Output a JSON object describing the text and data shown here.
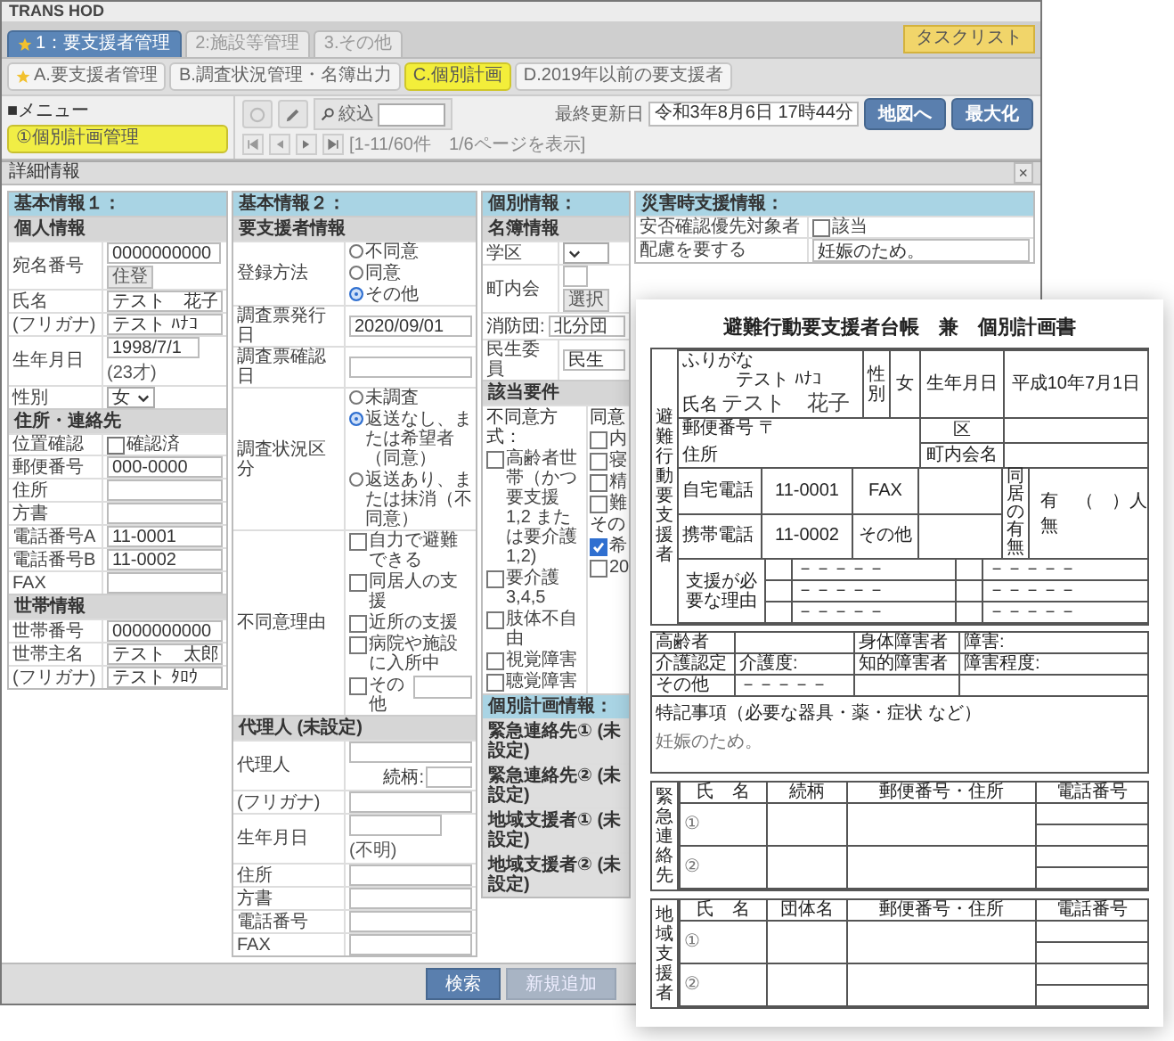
{
  "app": {
    "title": "TRANS HOD",
    "main_tabs": [
      {
        "label": "1：要支援者管理",
        "selected": true,
        "starred": true
      },
      {
        "label": "2:施設等管理",
        "selected": false,
        "starred": false
      },
      {
        "label": "3.その他",
        "selected": false,
        "starred": false
      }
    ],
    "task_button": "タスクリスト",
    "sub_tabs": [
      {
        "label": "A.要支援者管理",
        "selected": false,
        "starred": true
      },
      {
        "label": "B.調査状況管理・名簿出力",
        "selected": false,
        "starred": false
      },
      {
        "label": "C.個別計画",
        "selected": true,
        "starred": false
      },
      {
        "label": "D.2019年以前の要支援者",
        "selected": false,
        "starred": false
      }
    ],
    "menu": {
      "heading": "■メニュー",
      "items": [
        {
          "label": "①個別計画管理",
          "selected": true
        }
      ]
    },
    "toolbar": {
      "filter_label": "絞込",
      "paging": "[1-11/60件　1/6ページを表示]",
      "updated_label": "最終更新日",
      "updated_value": "令和3年8月6日 17時44分",
      "buttons": [
        "地図へ",
        "最大化"
      ]
    }
  },
  "dialog": {
    "title": "詳細情報",
    "close": "×",
    "panels": [
      {
        "title": "基本情報１：",
        "sections": [
          {
            "title": "個人情報",
            "rows": [
              {
                "kind": "field_button",
                "label": "宛名番号",
                "value": "0000000000",
                "button": "住登"
              },
              {
                "kind": "field",
                "label": "氏名",
                "value": "テスト　花子"
              },
              {
                "kind": "field",
                "label": "(フリガナ)",
                "value": "テスト ﾊﾅｺ"
              },
              {
                "kind": "field_note",
                "label": "生年月日",
                "value": "1998/7/1",
                "note": "(23才)"
              },
              {
                "kind": "select",
                "label": "性別",
                "value": "女"
              }
            ]
          },
          {
            "title": "住所・連絡先",
            "rows": [
              {
                "kind": "checks",
                "label": "位置確認",
                "options": [
                  {
                    "label": "確認済",
                    "checked": false
                  }
                ]
              },
              {
                "kind": "field",
                "label": "郵便番号",
                "value": "000-0000"
              },
              {
                "kind": "field",
                "label": "住所"
              },
              {
                "kind": "field",
                "label": "方書"
              },
              {
                "kind": "field",
                "label": "電話番号A",
                "value": "11-0001"
              },
              {
                "kind": "field",
                "label": "電話番号B",
                "value": "11-0002"
              },
              {
                "kind": "field",
                "label": "FAX"
              }
            ]
          },
          {
            "title": "世帯情報",
            "rows": [
              {
                "kind": "field",
                "label": "世帯番号",
                "value": "0000000000"
              },
              {
                "kind": "field",
                "label": "世帯主名",
                "value": "テスト　太郎"
              },
              {
                "kind": "field",
                "label": "(フリガナ)",
                "value": "テスト ﾀﾛｳ"
              }
            ]
          }
        ]
      },
      {
        "title": "基本情報２：",
        "sections": [
          {
            "title": "要支援者情報",
            "rows": [
              {
                "kind": "radios",
                "label": "登録方法",
                "options": [
                  {
                    "label": "不同意",
                    "selected": false
                  },
                  {
                    "label": "同意",
                    "selected": false
                  },
                  {
                    "label": "その他",
                    "selected": true
                  }
                ]
              },
              {
                "kind": "field",
                "label": "調査票発行日",
                "value": "2020/09/01"
              },
              {
                "kind": "field",
                "label": "調査票確認日"
              },
              {
                "kind": "radios",
                "label": "調査状況区分",
                "options": [
                  {
                    "label": "未調査",
                    "selected": false
                  },
                  {
                    "label": "返送なし、または希望者（同意）",
                    "selected": true
                  },
                  {
                    "label": "返送あり、または抹消（不同意）",
                    "selected": false
                  }
                ]
              },
              {
                "kind": "checks",
                "label": "不同意理由",
                "options": [
                  {
                    "label": "自力で避難できる",
                    "checked": false
                  },
                  {
                    "label": "同居人の支援",
                    "checked": false
                  },
                  {
                    "label": "近所の支援",
                    "checked": false
                  },
                  {
                    "label": "病院や施設に入所中",
                    "checked": false
                  },
                  {
                    "label": "その他",
                    "checked": false,
                    "with_field": true
                  }
                ]
              }
            ]
          },
          {
            "title": "代理人 (未設定)",
            "rows": [
              {
                "kind": "field_relation",
                "label": "代理人",
                "relation": "続柄:"
              },
              {
                "kind": "field",
                "label": "(フリガナ)"
              },
              {
                "kind": "field_note",
                "label": "生年月日",
                "note": "(不明)"
              },
              {
                "kind": "field",
                "label": "住所"
              },
              {
                "kind": "field",
                "label": "方書"
              },
              {
                "kind": "field",
                "label": "電話番号"
              },
              {
                "kind": "field",
                "label": "FAX"
              }
            ]
          }
        ]
      },
      {
        "title": "個別情報：",
        "sections": [
          {
            "title": "名簿情報",
            "rows": [
              {
                "kind": "select",
                "label": "学区"
              },
              {
                "kind": "field_button",
                "label": "町内会",
                "button": "選択"
              },
              {
                "kind": "inline_field",
                "label": "消防団:",
                "value": "北分団"
              },
              {
                "kind": "field",
                "label": "民生委員",
                "value": "民生"
              }
            ]
          },
          {
            "title": "該当要件",
            "rows": [
              {
                "kind": "columns",
                "columns": [
                  [
                    {
                      "kind": "text",
                      "label": "不同意方式："
                    },
                    {
                      "kind": "check",
                      "label": "高齢者世帯（かつ要支援1,2 または要介護1,2)",
                      "checked": false
                    },
                    {
                      "kind": "check",
                      "label": "要介護3,4,5",
                      "checked": false
                    },
                    {
                      "kind": "check",
                      "label": "肢体不自由",
                      "checked": false
                    },
                    {
                      "kind": "check",
                      "label": "視覚障害",
                      "checked": false
                    },
                    {
                      "kind": "check",
                      "label": "聴覚障害",
                      "checked": false
                    }
                  ],
                  [
                    {
                      "kind": "text",
                      "label": "同意"
                    },
                    {
                      "kind": "check",
                      "label": "内",
                      "checked": false
                    },
                    {
                      "kind": "check",
                      "label": "寝",
                      "checked": false
                    },
                    {
                      "kind": "check",
                      "label": "精",
                      "checked": false
                    },
                    {
                      "kind": "check",
                      "label": "難",
                      "checked": false
                    },
                    {
                      "kind": "text",
                      "label": "その"
                    },
                    {
                      "kind": "check",
                      "label": "希",
                      "checked": true
                    },
                    {
                      "kind": "check",
                      "label": "20",
                      "checked": false
                    }
                  ]
                ]
              }
            ]
          },
          {
            "title": "個別計画情報：",
            "kind": "links",
            "rows": [
              {
                "kind": "link",
                "label": "緊急連絡先① (未設定)"
              },
              {
                "kind": "link",
                "label": "緊急連絡先② (未設定)"
              },
              {
                "kind": "link",
                "label": "地域支援者① (未設定)"
              },
              {
                "kind": "link",
                "label": "地域支援者② (未設定)"
              }
            ]
          }
        ]
      },
      {
        "title": "災害時支援情報：",
        "sections": [
          {
            "rows": [
              {
                "kind": "checks",
                "label": "安否確認優先対象者",
                "options": [
                  {
                    "label": "該当",
                    "checked": false
                  }
                ]
              },
              {
                "kind": "textarea",
                "label": "配慮を要する",
                "value": "妊娠のため。"
              }
            ]
          }
        ]
      }
    ],
    "footer_buttons": [
      {
        "label": "検索",
        "disabled": false
      },
      {
        "label": "新規追加",
        "disabled": true
      }
    ]
  },
  "document": {
    "title": "避難行動要支援者台帳　兼　個別計画書",
    "side_label": "避難行動要支援者",
    "furigana_label": "ふりがな",
    "furigana": "テスト ﾊﾅｺ",
    "name_label": "氏名",
    "name": "テスト　花子",
    "sex_label": "性別",
    "sex": "女",
    "birth_label": "生年月日",
    "birth": "平成10年7月1日",
    "postal_label": "郵便番号 〒",
    "address_label": "住所",
    "ward_label": "区",
    "town_label": "町内会名",
    "phones": [
      {
        "label": "自宅電話",
        "value": "11-0001",
        "other_label": "FAX"
      },
      {
        "label": "携帯電話",
        "value": "11-0002",
        "other_label": "その他"
      }
    ],
    "cohabit_label": "同居の有無",
    "cohabit_options": [
      "有　（　）人",
      "無"
    ],
    "reason_label": "支援が必要な理由",
    "reasons": [
      [
        "－－－－－",
        "－－－－－"
      ],
      [
        "－－－－－",
        "－－－－－"
      ],
      [
        "－－－－－",
        "－－－－－"
      ]
    ],
    "conditions": [
      {
        "label": "高齢者",
        "label2": "身体障害者",
        "value2": "障害:"
      },
      {
        "label": "介護認定",
        "value": "介護度:",
        "label2": "知的障害者",
        "value2": "障害程度:"
      },
      {
        "label": "その他",
        "value": "－－－－－"
      }
    ],
    "notes_label": "特記事項（必要な器具・薬・症状 など）",
    "notes": "妊娠のため。",
    "contacts": [
      {
        "side_label": "緊急連絡先",
        "columns": [
          "氏　名",
          "続柄",
          "郵便番号・住所",
          "電話番号"
        ],
        "rows": [
          "①",
          "②"
        ]
      },
      {
        "side_label": "地域支援者",
        "columns": [
          "氏　名",
          "団体名",
          "郵便番号・住所",
          "電話番号"
        ],
        "rows": [
          "①",
          "②"
        ]
      }
    ]
  }
}
